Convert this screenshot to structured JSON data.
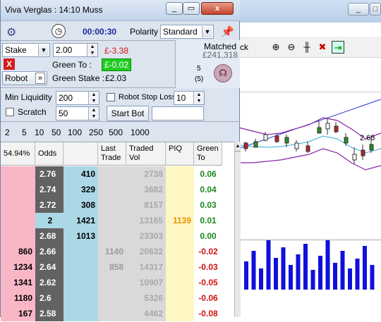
{
  "window": {
    "title": "Viva Verglas : 14:10 Muss",
    "min_icon": "minimize-icon",
    "max_icon": "maximize-icon",
    "close_label": "x"
  },
  "toolbar": {
    "timer": "00:00:30",
    "polarity_label": "Polarity",
    "polarity_value": "Standard"
  },
  "stake": {
    "type": "Stake",
    "value": "2.00",
    "pl": "£-3.38",
    "green_to_label": "Green To :",
    "green_to_value": "£-0.02",
    "green_stake_label": "Green Stake :",
    "green_stake_value": "£2.03"
  },
  "matched": {
    "label": "Matched",
    "amount": "£241,318",
    "count": "5",
    "sub": "(5)"
  },
  "robot": {
    "label": "Robot",
    "chevrons": "»"
  },
  "liquidity": {
    "label": "Min Liquidity",
    "value": "200",
    "scratch_label": "Scratch",
    "scratch_value": "50",
    "stop_loss_label": "Robot Stop Loss",
    "stop_loss_value": "10",
    "start_button": "Start Bot"
  },
  "stakes_presets": [
    "2",
    "5",
    "10",
    "50",
    "100",
    "250",
    "500",
    "1000"
  ],
  "grid": {
    "headers": {
      "pct": "54.94%",
      "odds": "Odds",
      "last": "Last Trade",
      "traded": "Traded Vol",
      "piq": "PIQ",
      "green": "Green To"
    },
    "rows": [
      {
        "lay": "",
        "odds": "2.76",
        "back": "410",
        "last": "",
        "traded": "2738",
        "piq": "",
        "green": "0.06"
      },
      {
        "lay": "",
        "odds": "2.74",
        "back": "329",
        "last": "",
        "traded": "3682",
        "piq": "",
        "green": "0.04"
      },
      {
        "lay": "",
        "odds": "2.72",
        "back": "308",
        "last": "",
        "traded": "8157",
        "piq": "",
        "green": "0.03"
      },
      {
        "lay": "",
        "odds": "2",
        "back": "1421",
        "last": "",
        "traded": "13165",
        "piq": "1139",
        "green": "0.01"
      },
      {
        "lay": "",
        "odds": "2.68",
        "back": "1013",
        "last": "",
        "traded": "23303",
        "piq": "",
        "green": "0.00"
      },
      {
        "lay": "860",
        "odds": "2.66",
        "back": "",
        "last": "1140",
        "traded": "20632",
        "piq": "",
        "green": "-0.02"
      },
      {
        "lay": "1234",
        "odds": "2.64",
        "back": "",
        "last": "858",
        "traded": "14317",
        "piq": "",
        "green": "-0.03"
      },
      {
        "lay": "1341",
        "odds": "2.62",
        "back": "",
        "last": "",
        "traded": "10907",
        "piq": "",
        "green": "-0.05"
      },
      {
        "lay": "1180",
        "odds": "2.6",
        "back": "",
        "last": "",
        "traded": "5326",
        "piq": "",
        "green": "-0.06"
      },
      {
        "lay": "167",
        "odds": "2.58",
        "back": "",
        "last": "",
        "traded": "4462",
        "piq": "",
        "green": "-0.08"
      }
    ]
  },
  "background_app": {
    "menu_fragment": "ck",
    "price_label": "2.68"
  },
  "colors": {
    "lay": "#f9b7c6",
    "back": "#abd7e6",
    "odds_dark": "#626262",
    "green_pos": "#1a8a1a",
    "green_neg": "#d11111",
    "piq": "#e89400",
    "highlight_green": "#22cc22"
  }
}
